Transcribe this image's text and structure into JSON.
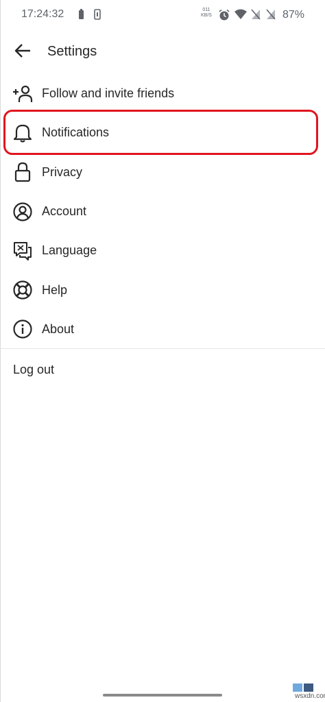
{
  "status_bar": {
    "time": "17:24:32",
    "net_speed_value": "011",
    "net_speed_unit": "KB/S",
    "battery_percent": "87%",
    "icons": [
      "battery-saver-icon",
      "phone-sync-icon",
      "alarm-icon",
      "wifi-icon",
      "no-sim-icon",
      "no-sim-icon"
    ]
  },
  "header": {
    "title": "Settings",
    "back_icon": "arrow-left-icon"
  },
  "menu": {
    "items": [
      {
        "label": "Follow and invite friends",
        "icon": "add-person-icon"
      },
      {
        "label": "Notifications",
        "icon": "bell-icon",
        "highlighted": true
      },
      {
        "label": "Privacy",
        "icon": "lock-icon"
      },
      {
        "label": "Account",
        "icon": "account-icon"
      },
      {
        "label": "Language",
        "icon": "translate-icon"
      },
      {
        "label": "Help",
        "icon": "lifebuoy-icon"
      },
      {
        "label": "About",
        "icon": "info-icon"
      }
    ]
  },
  "logout_label": "Log out",
  "highlight_color": "#e0141e",
  "watermark": "wsxdn.com"
}
